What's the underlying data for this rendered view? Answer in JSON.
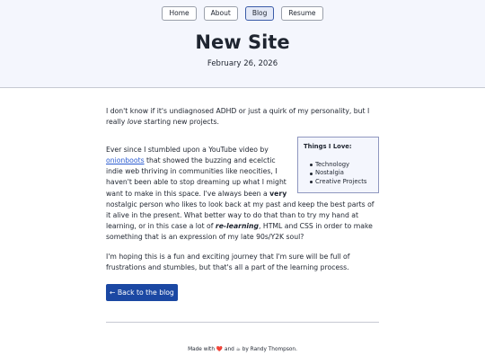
{
  "nav": {
    "items": [
      "Home",
      "About",
      "Blog",
      "Resume"
    ],
    "active": "Blog"
  },
  "header": {
    "title": "New Site",
    "date": "February 26, 2026"
  },
  "post": {
    "p1_before_em": "I don't know if it's undiagnosed ADHD or just a quirk of my personality, but I really",
    "p1_em": "love",
    "p1_after_em": "starting new projects.",
    "p2_before_link": "Ever since I stumbled upon a YouTube video by",
    "p2_link": "onionboots",
    "p2_middle": "that showed the buzzing and ecelctic indie web thriving in communities like neocities, I haven't been able to stop dreaming up what I might want to make in this space. I've always been a",
    "p2_strong": "very",
    "p2_after_strong": "nostalgic person who likes to look back at my past and keep the best parts of it alive in the present. What better way to do that than to try my hand at learning, or in this case a lot of",
    "p2_strong_em": "re-learning",
    "p2_end": ", HTML and CSS in order to make something that is an expression of my late 90s/Y2K soul?",
    "p3": "I'm hoping this is a fun and exciting journey that I'm sure will be full of frustrations and stumbles, but that's all a part of the learning process."
  },
  "sidebar": {
    "title": "Things I Love:",
    "items": [
      "Technology",
      "Nostalgia",
      "Creative Projects"
    ]
  },
  "back_button": "← Back to the blog",
  "footer": {
    "made_with": "Made with",
    "heart": "❤️",
    "and": "and",
    "coffee": "☕",
    "by": "by Randy Thompson."
  },
  "colors": {
    "header_bg": "#f4f6fd",
    "link": "#2a5bd0",
    "button_bg": "#1b48a3"
  },
  "icons": {
    "heart": "heart-icon",
    "coffee": "coffee-icon",
    "arrow": "arrow-left-icon"
  }
}
